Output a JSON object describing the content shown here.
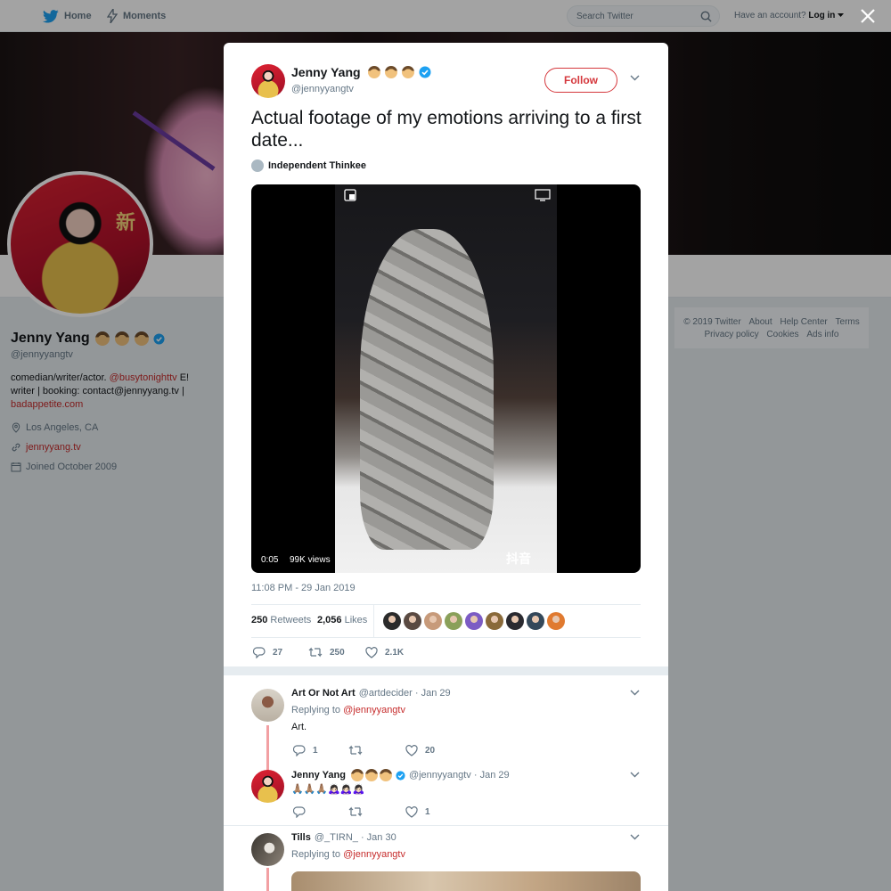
{
  "nav": {
    "home": "Home",
    "moments": "Moments"
  },
  "search": {
    "placeholder": "Search Twitter"
  },
  "account": {
    "prefix": "Have an account?",
    "login": "Log in"
  },
  "profile": {
    "name": "Jenny Yang",
    "handle": "@jennyyangtv",
    "bio_1": "comedian/writer/actor. ",
    "bio_mention": "@busytonighttv",
    "bio_2": " E! writer | booking: contact@jennyyang.tv | ",
    "bio_link": "badappetite.com",
    "location": "Los Angeles, CA",
    "website": "jennyyang.tv",
    "joined": "Joined October 2009",
    "banner_glyph": "新"
  },
  "footer": {
    "links": [
      "© 2019 Twitter",
      "About",
      "Help Center",
      "Terms",
      "Privacy policy",
      "Cookies",
      "Ads info"
    ]
  },
  "tweet": {
    "author_name": "Jenny Yang",
    "author_handle": "@jennyyangtv",
    "follow_label": "Follow",
    "text": "Actual footage of my emotions arriving to a first date...",
    "source": "Independent Thinkee",
    "video_time": "0:05",
    "video_views": "99K views",
    "video_watermark": "抖音",
    "timestamp": "11:08 PM - 29 Jan 2019",
    "retweets_count": "250",
    "retweets_label": "Retweets",
    "likes_count": "2,056",
    "likes_label": "Likes",
    "actions": {
      "replies": "27",
      "retweets": "250",
      "likes": "2.1K"
    },
    "liker_colors": [
      "#2b2b2b",
      "#5a4a42",
      "#c79a7a",
      "#8aa05a",
      "#7c5cc4",
      "#8a6a3a",
      "#2a2a30",
      "#34485a",
      "#e07a30"
    ]
  },
  "replies": [
    {
      "name": "Art Or Not Art",
      "handle": "@artdecider",
      "date": "· Jan 29",
      "replying_prefix": "Replying to",
      "replying_to": "@jennyyangtv",
      "text": "Art.",
      "replies": "1",
      "retweets": "",
      "likes": "20"
    },
    {
      "name": "Jenny Yang",
      "handle": "@jennyyangtv",
      "date": "· Jan 29",
      "text": "🙏🏽🙏🏽🙏🏽🙇🏻‍♀️🙇🏻‍♀️🙇🏻‍♀️",
      "replies": "",
      "retweets": "",
      "likes": "1"
    },
    {
      "name": "Tills",
      "handle": "@_TIRN_",
      "date": "· Jan 30",
      "replying_prefix": "Replying to",
      "replying_to": "@jennyyangtv"
    }
  ],
  "colors": {
    "accent": "#d5383d",
    "link": "#c62b2b",
    "verified": "#1da1f2",
    "twitter_blue": "#1da1f2",
    "text_secondary": "#657786"
  }
}
